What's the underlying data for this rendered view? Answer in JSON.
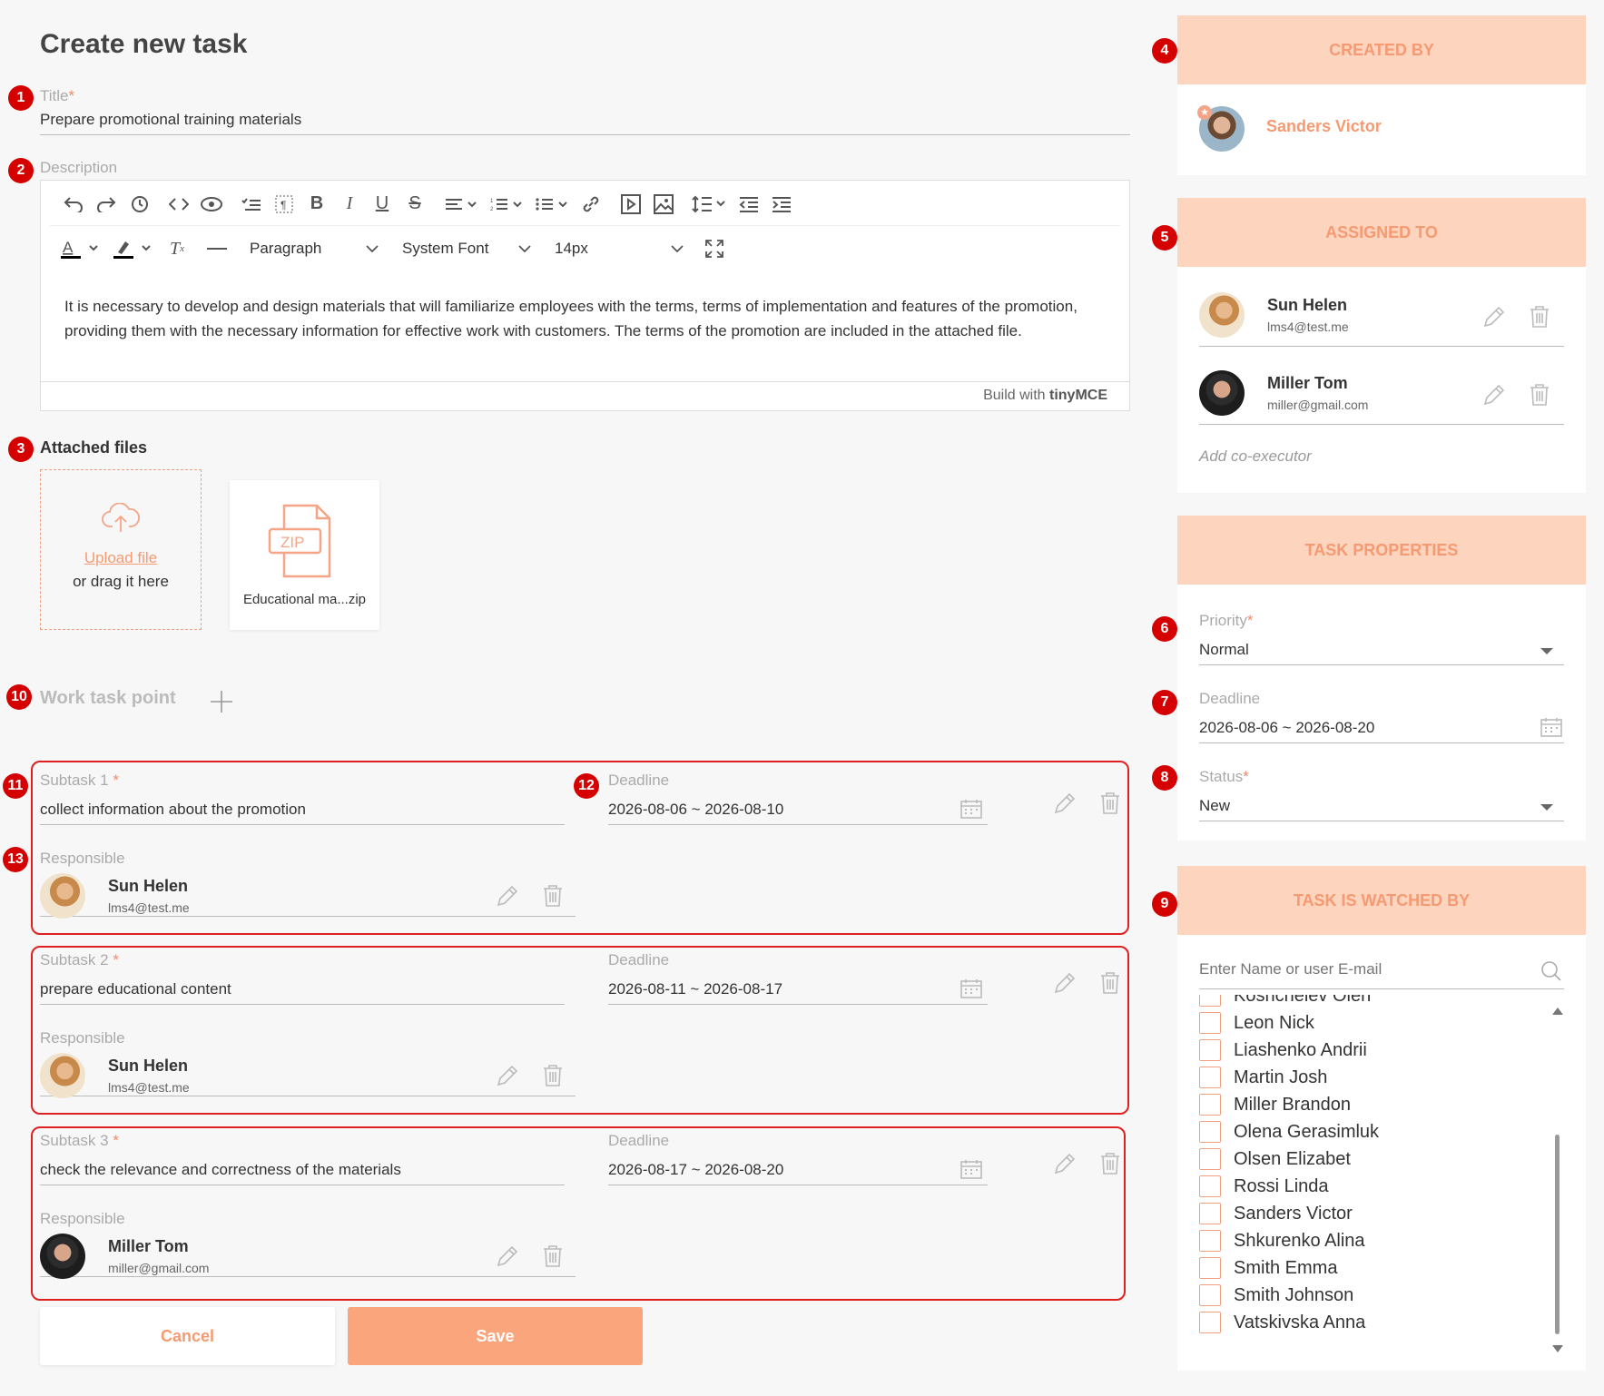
{
  "page_title": "Create new task",
  "markers": [
    "1",
    "2",
    "3",
    "4",
    "5",
    "6",
    "7",
    "8",
    "9",
    "10",
    "11",
    "12",
    "13"
  ],
  "title_field": {
    "label": "Title",
    "required": "*",
    "value": "Prepare promotional training materials"
  },
  "description": {
    "label": "Description",
    "toolbar": {
      "block_format": "Paragraph",
      "font_family": "System Font",
      "font_size": "14px"
    },
    "text": "It is necessary to develop and design materials that will familiarize employees with the terms, terms of implementation and features of the promotion, providing them with the necessary information for effective work with customers. The terms of the promotion are included in the attached file.",
    "footer_prefix": "Build with",
    "footer_brand": "tinyMCE"
  },
  "attached_files": {
    "label": "Attached files",
    "upload_link": "Upload file",
    "upload_hint": "or drag it here",
    "files": [
      {
        "type": "ZIP",
        "name": "Educational ma...zip"
      }
    ]
  },
  "work_task_point": {
    "label": "Work task point"
  },
  "subtasks": [
    {
      "label": "Subtask 1",
      "required": "*",
      "value": "collect information about the promotion",
      "deadline_label": "Deadline",
      "deadline": "2026-08-06 ~ 2026-08-10",
      "responsible_label": "Responsible",
      "responsible": {
        "name": "Sun Helen",
        "email": "lms4@test.me"
      }
    },
    {
      "label": "Subtask 2",
      "required": "*",
      "value": "prepare educational content",
      "deadline_label": "Deadline",
      "deadline": "2026-08-11 ~ 2026-08-17",
      "responsible_label": "Responsible",
      "responsible": {
        "name": "Sun Helen",
        "email": "lms4@test.me"
      }
    },
    {
      "label": "Subtask 3",
      "required": "*",
      "value": "check the relevance and correctness of the materials",
      "deadline_label": "Deadline",
      "deadline": "2026-08-17 ~ 2026-08-20",
      "responsible_label": "Responsible",
      "responsible": {
        "name": "Miller Tom",
        "email": "miller@gmail.com"
      }
    }
  ],
  "buttons": {
    "cancel": "Cancel",
    "save": "Save"
  },
  "created_by": {
    "header": "CREATED BY",
    "name": "Sanders Victor"
  },
  "assigned_to": {
    "header": "ASSIGNED TO",
    "people": [
      {
        "name": "Sun Helen",
        "email": "lms4@test.me"
      },
      {
        "name": "Miller Tom",
        "email": "miller@gmail.com"
      }
    ],
    "add_placeholder": "Add co-executor"
  },
  "task_properties": {
    "header": "TASK PROPERTIES",
    "priority_label": "Priority",
    "priority_required": "*",
    "priority": "Normal",
    "deadline_label": "Deadline",
    "deadline": "2026-08-06 ~ 2026-08-20",
    "status_label": "Status",
    "status_required": "*",
    "status": "New"
  },
  "watched_by": {
    "header": "TASK IS WATCHED BY",
    "search_placeholder": "Enter Name or user E-mail",
    "partial_item": "Koshcheiev Oleh",
    "items": [
      "Leon Nick",
      "Liashenko Andrii",
      "Martin Josh",
      "Miller Brandon",
      "Olena Gerasimluk",
      "Olsen Elizabet",
      "Rossi Linda",
      "Sanders Victor",
      "Shkurenko Alina",
      "Smith Emma",
      "Smith Johnson",
      "Vatskivska Anna"
    ]
  },
  "colors": {
    "accent": "#f59a72",
    "panel_header_bg": "#fdd4bd",
    "save_bg": "#fba57d",
    "marker": "#d50000",
    "subtask_border": "#e02020"
  }
}
